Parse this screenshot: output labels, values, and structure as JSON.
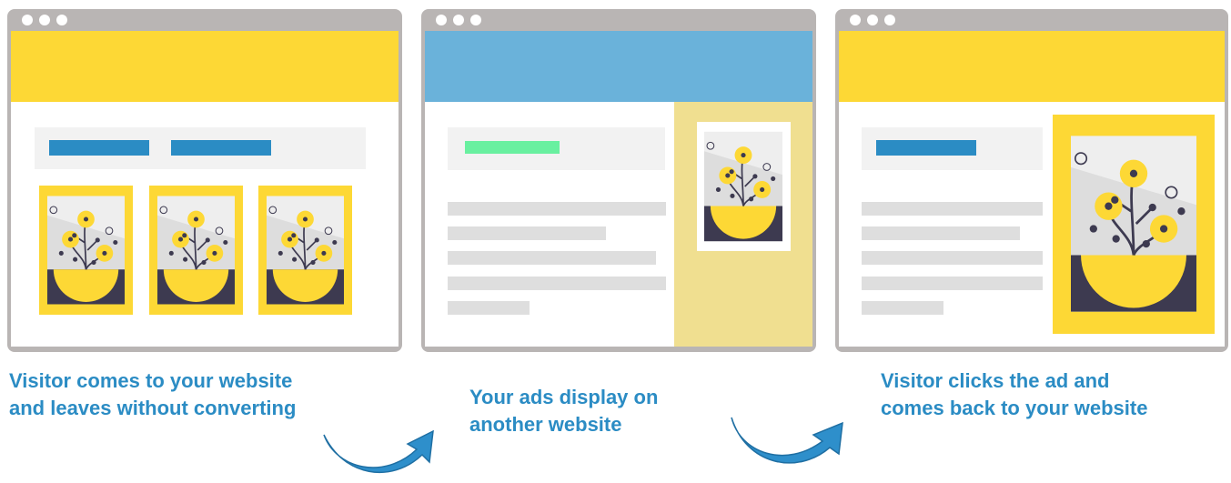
{
  "colors": {
    "frame_gray": "#b9b5b4",
    "hero_yellow": "#fdd835",
    "hero_blue": "#6ab2da",
    "nav_blue": "#2b8cc4",
    "nav_green": "#69f0a0",
    "ad_column": "#f0df90",
    "text_line": "#dedede",
    "caption": "#2b8cc4",
    "arrow": "#2e8fcb"
  },
  "windows": [
    {
      "dots": [
        "dot",
        "dot",
        "dot"
      ],
      "hero": "yellow",
      "ad_images": 3
    },
    {
      "dots": [
        "dot",
        "dot",
        "dot"
      ],
      "hero": "blue",
      "ad_images": 1
    },
    {
      "dots": [
        "dot",
        "dot",
        "dot"
      ],
      "hero": "yellow",
      "ad_images": 1
    }
  ],
  "steps": [
    {
      "caption": "Visitor comes to your website and leaves without converting"
    },
    {
      "caption": "Your ads display on another website"
    },
    {
      "caption": "Visitor clicks the ad and comes back to your website"
    }
  ],
  "icons": {
    "flower_art": "potted-flowers-illustration",
    "arrow": "curved-arrow-right"
  }
}
